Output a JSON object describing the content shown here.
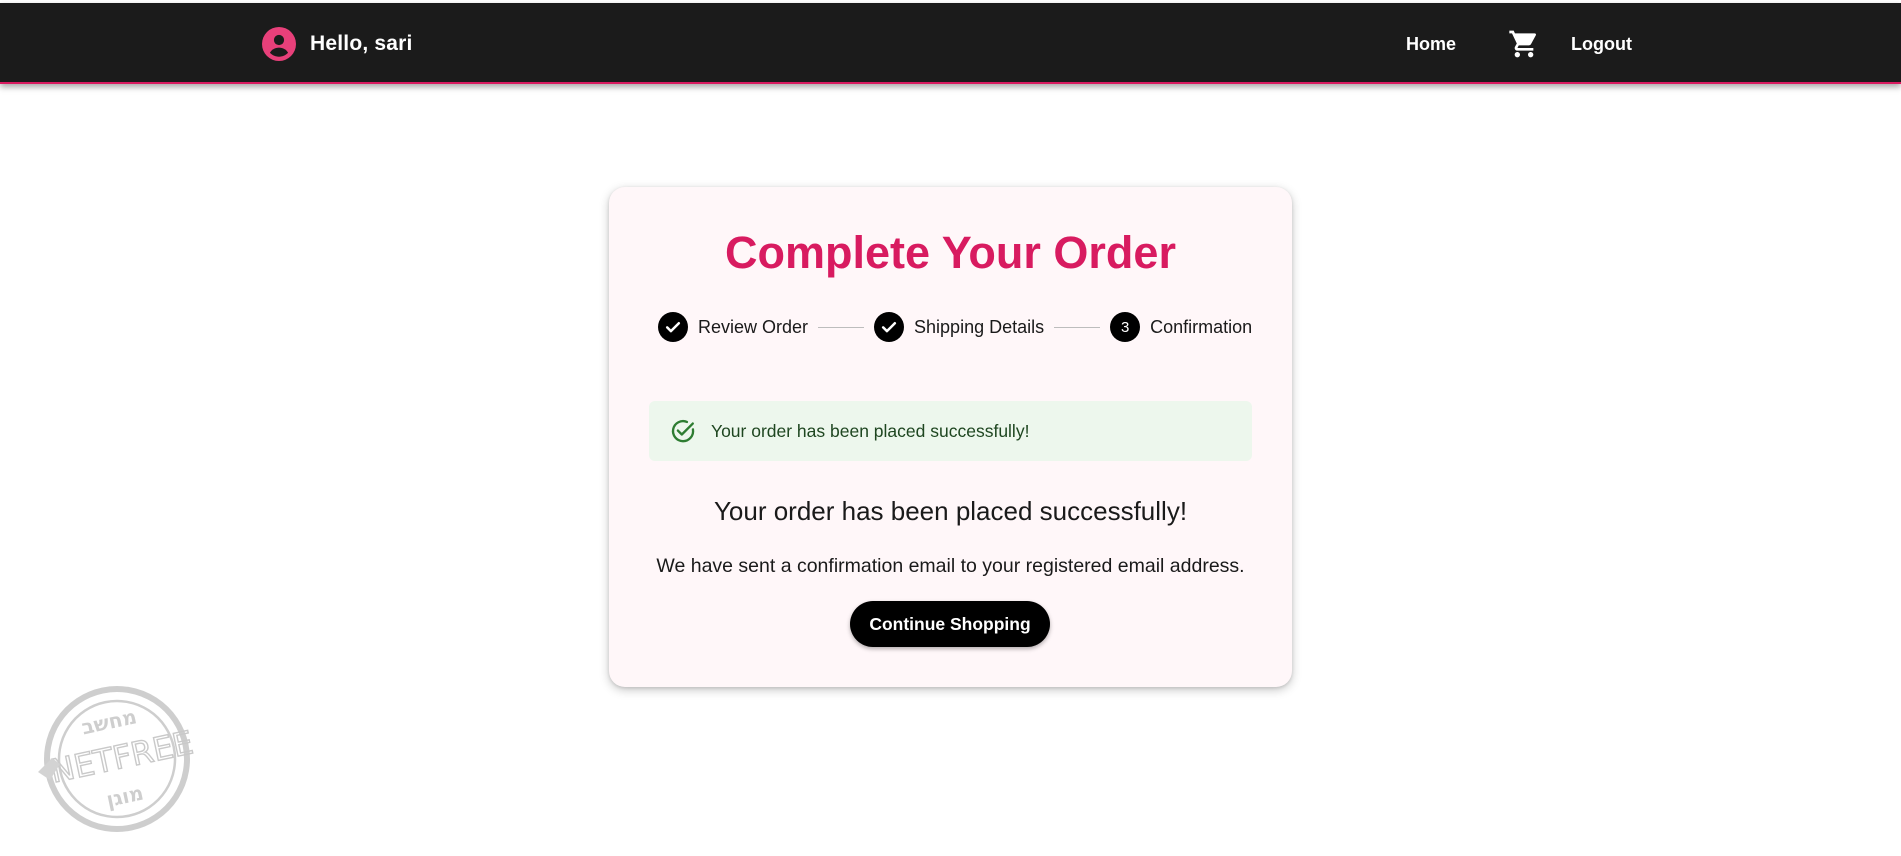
{
  "header": {
    "greeting": "Hello, sari",
    "avatar_icon": "account-circle-icon",
    "nav": {
      "home_label": "Home",
      "cart_icon": "shopping-cart-icon",
      "logout_label": "Logout"
    }
  },
  "card": {
    "title": "Complete Your Order",
    "steps": [
      {
        "label": "Review Order",
        "state": "completed",
        "icon": "check-icon"
      },
      {
        "label": "Shipping Details",
        "state": "completed",
        "icon": "check-icon"
      },
      {
        "label": "Confirmation",
        "state": "active",
        "number": "3"
      }
    ],
    "alert": {
      "icon": "check-circle-outline-icon",
      "message": "Your order has been placed successfully!"
    },
    "heading": "Your order has been placed successfully!",
    "subtext": "We have sent a confirmation email to your registered email address.",
    "continue_label": "Continue Shopping"
  },
  "watermark": {
    "top_text": "מחשב",
    "middle_text": "NETFREE",
    "bottom_text": "מוגן"
  },
  "colors": {
    "appbar_bg": "#1b1b1b",
    "accent": "#d81b60",
    "card_bg": "#fff7f9",
    "alert_bg": "#edf7ed",
    "alert_text": "#1e4620",
    "button_bg": "#000000"
  }
}
